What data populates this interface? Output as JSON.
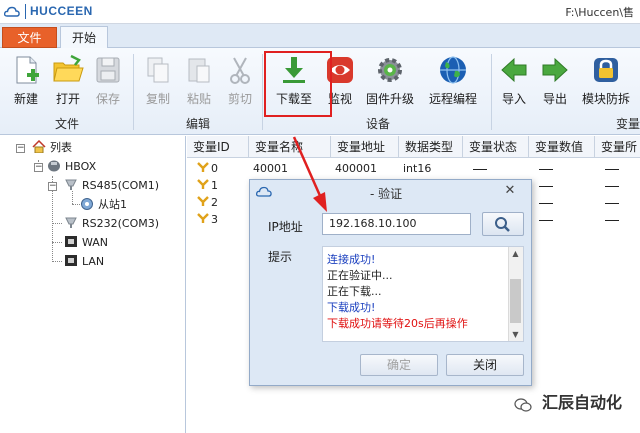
{
  "app": {
    "name": "HUCCEEN",
    "path": "F:\\Huccen\\售"
  },
  "tabs": {
    "file": "文件",
    "start": "开始"
  },
  "ribbon": {
    "buttons": [
      {
        "label": "新建",
        "icon": "new-file-icon",
        "enabled": true
      },
      {
        "label": "打开",
        "icon": "folder-open-icon",
        "enabled": true
      },
      {
        "label": "保存",
        "icon": "save-icon",
        "enabled": false
      },
      {
        "label": "复制",
        "icon": "copy-icon",
        "enabled": false
      },
      {
        "label": "粘贴",
        "icon": "paste-icon",
        "enabled": false
      },
      {
        "label": "剪切",
        "icon": "scissors-icon",
        "enabled": false
      },
      {
        "label": "下载至",
        "icon": "download-icon",
        "enabled": true
      },
      {
        "label": "监视",
        "icon": "eye-icon",
        "enabled": true
      },
      {
        "label": "固件升级",
        "icon": "gear-icon",
        "enabled": true
      },
      {
        "label": "远程编程",
        "icon": "globe-icon",
        "enabled": true
      },
      {
        "label": "导入",
        "icon": "import-arrow-icon",
        "enabled": true
      },
      {
        "label": "导出",
        "icon": "export-arrow-icon",
        "enabled": true
      },
      {
        "label": "模块防拆",
        "icon": "lock-icon",
        "enabled": true
      }
    ],
    "groups": {
      "file": "文件",
      "edit": "编辑",
      "device": "设备",
      "variable": "变量"
    }
  },
  "tree": {
    "root": "列表",
    "hbox": "HBOX",
    "rs485": "RS485(COM1)",
    "slave": "从站1",
    "rs232": "RS232(COM3)",
    "wan": "WAN",
    "lan": "LAN"
  },
  "grid": {
    "columns": [
      "变量ID",
      "变量名称",
      "变量地址",
      "数据类型",
      "变量状态",
      "变量数值",
      "变量所"
    ],
    "rows": [
      {
        "id": "0",
        "name": "40001",
        "addr": "400001",
        "type": "int16"
      },
      {
        "id": "1",
        "name": "",
        "addr": "",
        "type": ""
      },
      {
        "id": "2",
        "name": "",
        "addr": "",
        "type": ""
      },
      {
        "id": "3",
        "name": "",
        "addr": "",
        "type": ""
      }
    ]
  },
  "dialog": {
    "title": "- 验证",
    "ip_label": "IP地址",
    "ip_value": "192.168.10.100",
    "tip_label": "提示",
    "log": [
      {
        "text": "连接成功!",
        "color": "#1a3fbf"
      },
      {
        "text": "正在验证中...",
        "color": "#222222"
      },
      {
        "text": "正在下载...",
        "color": "#222222"
      },
      {
        "text": "下载成功!",
        "color": "#1a3fbf"
      },
      {
        "text": "下载成功请等待20s后再操作",
        "color": "#e01010"
      }
    ],
    "ok": "确定",
    "close": "关闭"
  },
  "watermark": "汇辰自动化",
  "colors": {
    "accent": "#e8612a",
    "highlight": "#e02020",
    "link_blue": "#1a3fbf"
  }
}
